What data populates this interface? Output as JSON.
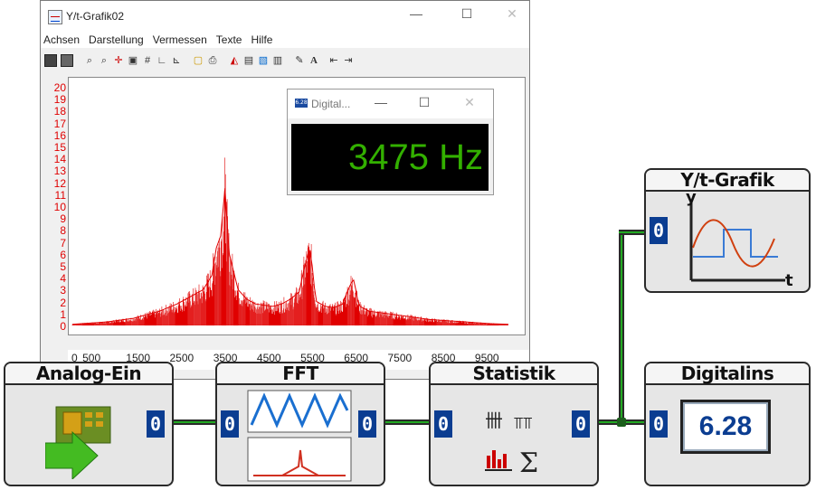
{
  "window": {
    "title": "Y/t-Grafik02",
    "minimize": "—",
    "maximize": "☐",
    "close": "✕"
  },
  "menu": [
    "Achsen",
    "Darstellung",
    "Vermessen",
    "Texte",
    "Hilfe"
  ],
  "toolbar_icons": [
    "export-icon",
    "export2-icon",
    "zoom-in-icon",
    "zoom-out-icon",
    "cursor-icon",
    "save-icon",
    "grid-icon",
    "axis-icon",
    "axis2-icon",
    "copy-icon",
    "print-icon",
    "chart-icon",
    "chart2-icon",
    "chart3-icon",
    "bars-icon",
    "brush-icon",
    "text-icon",
    "nav-left-icon",
    "nav-right-icon"
  ],
  "chart_data": {
    "type": "line",
    "xlabel": "",
    "ylabel": "",
    "xlim": [
      0,
      10000
    ],
    "ylim": [
      0,
      20
    ],
    "x_ticks": [
      "0",
      "500",
      "1500",
      "2500",
      "3500",
      "4500",
      "5500",
      "6500",
      "7500",
      "8500",
      "9500"
    ],
    "y_ticks": [
      "0",
      "1",
      "2",
      "3",
      "4",
      "5",
      "6",
      "7",
      "8",
      "9",
      "10",
      "11",
      "12",
      "13",
      "14",
      "15",
      "16",
      "17",
      "18",
      "19",
      "20"
    ],
    "series": [
      {
        "color": "#e00000",
        "x": [
          0,
          200,
          400,
          600,
          800,
          1000,
          1200,
          1400,
          1600,
          1800,
          2000,
          2200,
          2400,
          2600,
          2800,
          3000,
          3200,
          3300,
          3400,
          3450,
          3500,
          3550,
          3600,
          3700,
          3800,
          3900,
          4000,
          4200,
          4400,
          4600,
          4800,
          5000,
          5200,
          5300,
          5400,
          5450,
          5500,
          5550,
          5600,
          5700,
          5800,
          6000,
          6200,
          6300,
          6400,
          6450,
          6500,
          6550,
          6600,
          6700,
          6800,
          7000,
          7200,
          7400,
          7600,
          7800,
          8000,
          8200,
          8400,
          8600,
          8800,
          9000,
          9200,
          9400,
          9600,
          9800,
          10000
        ],
        "y": [
          0.1,
          0.15,
          0.2,
          0.25,
          0.3,
          0.4,
          0.5,
          0.6,
          0.8,
          1.0,
          1.2,
          1.5,
          1.8,
          2.2,
          2.6,
          3.0,
          4.2,
          6.5,
          7.5,
          9.5,
          11.5,
          8.5,
          6.0,
          4.5,
          3.0,
          2.6,
          2.2,
          1.8,
          1.7,
          1.6,
          1.8,
          2.2,
          2.8,
          4.5,
          6.0,
          6.2,
          5.0,
          3.2,
          2.0,
          1.8,
          1.6,
          1.5,
          1.8,
          2.8,
          3.6,
          3.8,
          3.0,
          2.0,
          1.6,
          1.4,
          1.2,
          1.1,
          1.0,
          0.9,
          0.8,
          0.7,
          0.6,
          0.5,
          0.45,
          0.4,
          0.35,
          0.3,
          0.25,
          0.2,
          0.15,
          0.12,
          0.1
        ]
      }
    ]
  },
  "digital_window": {
    "title": "Digital...",
    "icon_label": "6.28",
    "value": "3475",
    "unit": "Hz"
  },
  "blocks": {
    "analog": {
      "title": "Analog-Ein",
      "port_out": "0"
    },
    "fft": {
      "title": "FFT",
      "port_in": "0",
      "port_out": "0"
    },
    "statistik": {
      "title": "Statistik",
      "port_in": "0",
      "port_out": "0"
    },
    "digitalins": {
      "title": "Digitalins",
      "port_in": "0",
      "display": "6.28"
    },
    "yt": {
      "title": "Y/t-Grafik",
      "port_in": "0",
      "axis_y": "y",
      "axis_t": "t"
    }
  },
  "colors": {
    "plot_line": "#e00000",
    "axis_label": "#e00000",
    "display_text": "#33b000",
    "port": "#0b3d91",
    "wire": "#22aa22"
  }
}
